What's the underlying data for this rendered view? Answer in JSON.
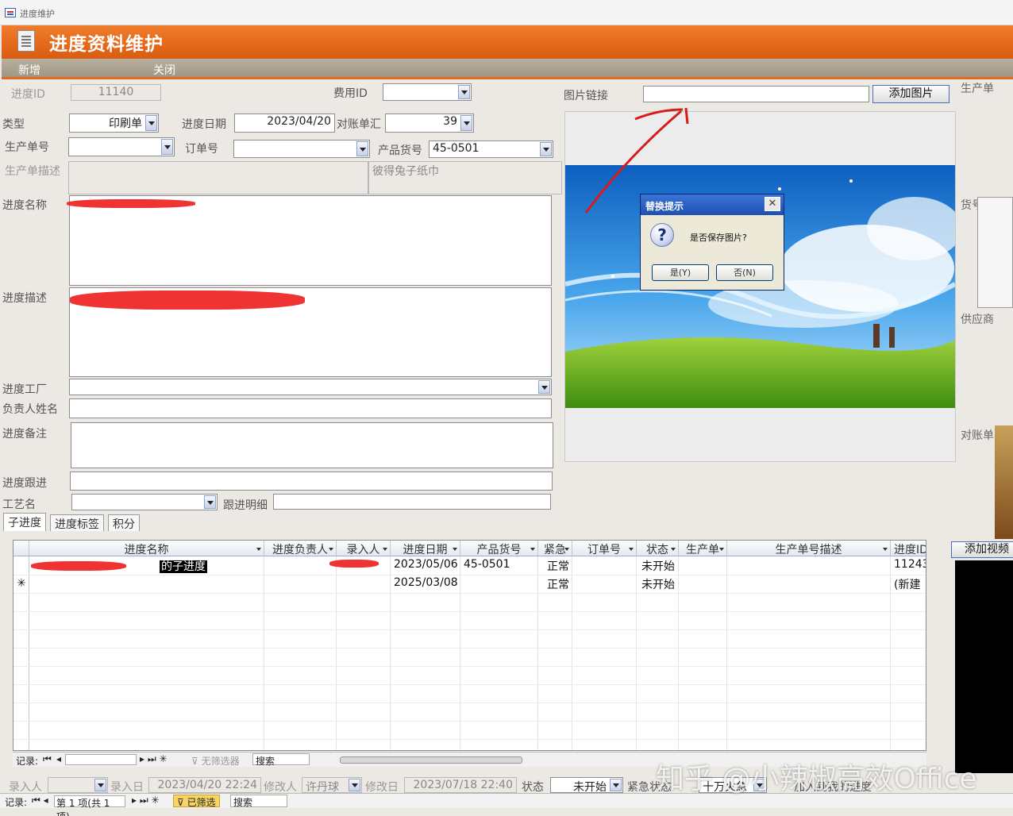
{
  "window": {
    "title": "进度维护"
  },
  "banner": {
    "title": "进度资料维护"
  },
  "toolbar": {
    "new_label": "新增",
    "close_label": "关闭"
  },
  "form": {
    "progress_id_label": "进度ID",
    "progress_id_value": "11140",
    "fee_id_label": "费用ID",
    "fee_id_value": "",
    "image_link_label": "图片链接",
    "image_link_value": "",
    "add_image_label": "添加图片",
    "type_label": "类型",
    "type_value": "印刷单",
    "date_label": "进度日期",
    "date_value": "2023/04/20",
    "statement_label": "对账单汇",
    "statement_value": "39",
    "prod_order_label": "生产单号",
    "prod_order_value": "",
    "order_label": "订单号",
    "order_value": "",
    "product_code_label": "产品货号",
    "product_code_value": "45-0501",
    "prod_desc_label": "生产单描述",
    "prod_desc_value": "",
    "prod_desc_value2": "彼得兔子纸巾",
    "name_label": "进度名称",
    "desc_label": "进度描述",
    "factory_label": "进度工厂",
    "owner_label": "负责人姓名",
    "remark_label": "进度备注",
    "follow_label": "进度跟进",
    "process_label": "工艺名",
    "follow_detail_label": "跟进明细"
  },
  "side_labels": {
    "production": "生产单",
    "goods": "货号",
    "supplier": "供应商",
    "statement": "对账单",
    "add_video": "添加视频"
  },
  "dialog": {
    "title": "替换提示",
    "close": "✕",
    "icon": "?",
    "message": "是否保存图片?",
    "yes": "是(Y)",
    "no": "否(N)"
  },
  "tabs": [
    "子进度",
    "进度标签",
    "积分"
  ],
  "grid": {
    "columns": [
      "进度名称",
      "进度负责人",
      "录入人",
      "进度日期",
      "产品货号",
      "紧急",
      "订单号",
      "状态",
      "生产单",
      "生产单号描述",
      "进度ID"
    ],
    "rows": [
      {
        "name": "的子进度",
        "owner": "",
        "entry": "",
        "date": "2023/05/06",
        "code": "45-0501",
        "urgent": "正常",
        "order": "",
        "status": "未开始",
        "prod": "",
        "proddesc": "",
        "id": "11243"
      },
      {
        "name": "",
        "owner": "",
        "entry": "",
        "date": "2025/03/08",
        "code": "",
        "urgent": "正常",
        "order": "",
        "status": "未开始",
        "prod": "",
        "proddesc": "",
        "id": "(新建"
      }
    ],
    "new_row_marker": "✳"
  },
  "grid_nav": {
    "label": "记录:",
    "filter": "无筛选器",
    "search": "搜索"
  },
  "footer": {
    "entry_label": "录入人",
    "entry_value": "",
    "entry_date_label": "录入日",
    "entry_date_value": "2023/04/20 22:24",
    "modifier_label": "修改人",
    "modifier_value": "许丹球",
    "modify_date_label": "修改日",
    "modify_date_value": "2023/07/18 22:40",
    "status_label": "状态",
    "status_value": "未开始",
    "urgent_label": "紧急状态",
    "urgent_value": "十万火急",
    "extra_label": "加入到我的进度"
  },
  "bottom_nav": {
    "label": "记录:",
    "position": "第 1 项(共 1 项)",
    "filter": "已筛选",
    "search": "搜索"
  },
  "watermark": "知乎 @小辣椒高效Office"
}
